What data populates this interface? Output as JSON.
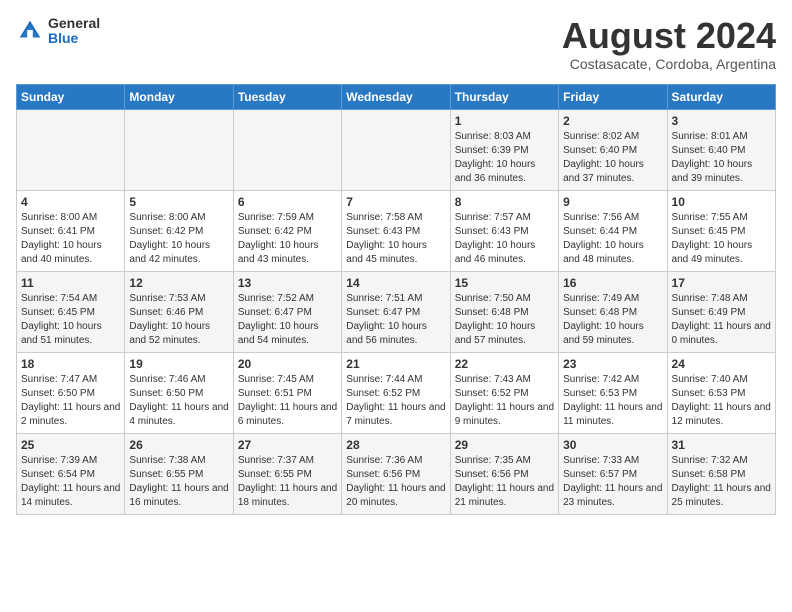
{
  "logo": {
    "general": "General",
    "blue": "Blue"
  },
  "header": {
    "month": "August 2024",
    "location": "Costasacate, Cordoba, Argentina"
  },
  "weekdays": [
    "Sunday",
    "Monday",
    "Tuesday",
    "Wednesday",
    "Thursday",
    "Friday",
    "Saturday"
  ],
  "weeks": [
    [
      {
        "day": "",
        "sunrise": "",
        "sunset": "",
        "daylight": ""
      },
      {
        "day": "",
        "sunrise": "",
        "sunset": "",
        "daylight": ""
      },
      {
        "day": "",
        "sunrise": "",
        "sunset": "",
        "daylight": ""
      },
      {
        "day": "",
        "sunrise": "",
        "sunset": "",
        "daylight": ""
      },
      {
        "day": "1",
        "sunrise": "Sunrise: 8:03 AM",
        "sunset": "Sunset: 6:39 PM",
        "daylight": "Daylight: 10 hours and 36 minutes."
      },
      {
        "day": "2",
        "sunrise": "Sunrise: 8:02 AM",
        "sunset": "Sunset: 6:40 PM",
        "daylight": "Daylight: 10 hours and 37 minutes."
      },
      {
        "day": "3",
        "sunrise": "Sunrise: 8:01 AM",
        "sunset": "Sunset: 6:40 PM",
        "daylight": "Daylight: 10 hours and 39 minutes."
      }
    ],
    [
      {
        "day": "4",
        "sunrise": "Sunrise: 8:00 AM",
        "sunset": "Sunset: 6:41 PM",
        "daylight": "Daylight: 10 hours and 40 minutes."
      },
      {
        "day": "5",
        "sunrise": "Sunrise: 8:00 AM",
        "sunset": "Sunset: 6:42 PM",
        "daylight": "Daylight: 10 hours and 42 minutes."
      },
      {
        "day": "6",
        "sunrise": "Sunrise: 7:59 AM",
        "sunset": "Sunset: 6:42 PM",
        "daylight": "Daylight: 10 hours and 43 minutes."
      },
      {
        "day": "7",
        "sunrise": "Sunrise: 7:58 AM",
        "sunset": "Sunset: 6:43 PM",
        "daylight": "Daylight: 10 hours and 45 minutes."
      },
      {
        "day": "8",
        "sunrise": "Sunrise: 7:57 AM",
        "sunset": "Sunset: 6:43 PM",
        "daylight": "Daylight: 10 hours and 46 minutes."
      },
      {
        "day": "9",
        "sunrise": "Sunrise: 7:56 AM",
        "sunset": "Sunset: 6:44 PM",
        "daylight": "Daylight: 10 hours and 48 minutes."
      },
      {
        "day": "10",
        "sunrise": "Sunrise: 7:55 AM",
        "sunset": "Sunset: 6:45 PM",
        "daylight": "Daylight: 10 hours and 49 minutes."
      }
    ],
    [
      {
        "day": "11",
        "sunrise": "Sunrise: 7:54 AM",
        "sunset": "Sunset: 6:45 PM",
        "daylight": "Daylight: 10 hours and 51 minutes."
      },
      {
        "day": "12",
        "sunrise": "Sunrise: 7:53 AM",
        "sunset": "Sunset: 6:46 PM",
        "daylight": "Daylight: 10 hours and 52 minutes."
      },
      {
        "day": "13",
        "sunrise": "Sunrise: 7:52 AM",
        "sunset": "Sunset: 6:47 PM",
        "daylight": "Daylight: 10 hours and 54 minutes."
      },
      {
        "day": "14",
        "sunrise": "Sunrise: 7:51 AM",
        "sunset": "Sunset: 6:47 PM",
        "daylight": "Daylight: 10 hours and 56 minutes."
      },
      {
        "day": "15",
        "sunrise": "Sunrise: 7:50 AM",
        "sunset": "Sunset: 6:48 PM",
        "daylight": "Daylight: 10 hours and 57 minutes."
      },
      {
        "day": "16",
        "sunrise": "Sunrise: 7:49 AM",
        "sunset": "Sunset: 6:48 PM",
        "daylight": "Daylight: 10 hours and 59 minutes."
      },
      {
        "day": "17",
        "sunrise": "Sunrise: 7:48 AM",
        "sunset": "Sunset: 6:49 PM",
        "daylight": "Daylight: 11 hours and 0 minutes."
      }
    ],
    [
      {
        "day": "18",
        "sunrise": "Sunrise: 7:47 AM",
        "sunset": "Sunset: 6:50 PM",
        "daylight": "Daylight: 11 hours and 2 minutes."
      },
      {
        "day": "19",
        "sunrise": "Sunrise: 7:46 AM",
        "sunset": "Sunset: 6:50 PM",
        "daylight": "Daylight: 11 hours and 4 minutes."
      },
      {
        "day": "20",
        "sunrise": "Sunrise: 7:45 AM",
        "sunset": "Sunset: 6:51 PM",
        "daylight": "Daylight: 11 hours and 6 minutes."
      },
      {
        "day": "21",
        "sunrise": "Sunrise: 7:44 AM",
        "sunset": "Sunset: 6:52 PM",
        "daylight": "Daylight: 11 hours and 7 minutes."
      },
      {
        "day": "22",
        "sunrise": "Sunrise: 7:43 AM",
        "sunset": "Sunset: 6:52 PM",
        "daylight": "Daylight: 11 hours and 9 minutes."
      },
      {
        "day": "23",
        "sunrise": "Sunrise: 7:42 AM",
        "sunset": "Sunset: 6:53 PM",
        "daylight": "Daylight: 11 hours and 11 minutes."
      },
      {
        "day": "24",
        "sunrise": "Sunrise: 7:40 AM",
        "sunset": "Sunset: 6:53 PM",
        "daylight": "Daylight: 11 hours and 12 minutes."
      }
    ],
    [
      {
        "day": "25",
        "sunrise": "Sunrise: 7:39 AM",
        "sunset": "Sunset: 6:54 PM",
        "daylight": "Daylight: 11 hours and 14 minutes."
      },
      {
        "day": "26",
        "sunrise": "Sunrise: 7:38 AM",
        "sunset": "Sunset: 6:55 PM",
        "daylight": "Daylight: 11 hours and 16 minutes."
      },
      {
        "day": "27",
        "sunrise": "Sunrise: 7:37 AM",
        "sunset": "Sunset: 6:55 PM",
        "daylight": "Daylight: 11 hours and 18 minutes."
      },
      {
        "day": "28",
        "sunrise": "Sunrise: 7:36 AM",
        "sunset": "Sunset: 6:56 PM",
        "daylight": "Daylight: 11 hours and 20 minutes."
      },
      {
        "day": "29",
        "sunrise": "Sunrise: 7:35 AM",
        "sunset": "Sunset: 6:56 PM",
        "daylight": "Daylight: 11 hours and 21 minutes."
      },
      {
        "day": "30",
        "sunrise": "Sunrise: 7:33 AM",
        "sunset": "Sunset: 6:57 PM",
        "daylight": "Daylight: 11 hours and 23 minutes."
      },
      {
        "day": "31",
        "sunrise": "Sunrise: 7:32 AM",
        "sunset": "Sunset: 6:58 PM",
        "daylight": "Daylight: 11 hours and 25 minutes."
      }
    ]
  ]
}
